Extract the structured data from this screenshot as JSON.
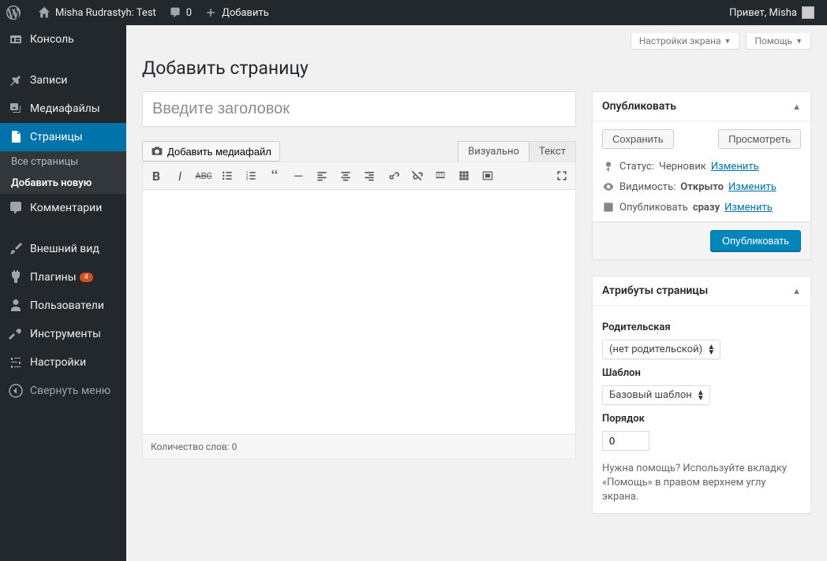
{
  "adminBar": {
    "siteName": "Misha Rudrastyh: Test",
    "comments": "0",
    "addNew": "Добавить",
    "greeting": "Привет, Misha"
  },
  "sidebar": {
    "items": [
      {
        "label": "Консоль"
      },
      {
        "label": "Записи"
      },
      {
        "label": "Медиафайлы"
      },
      {
        "label": "Страницы"
      },
      {
        "label": "Комментарии"
      },
      {
        "label": "Внешний вид"
      },
      {
        "label": "Плагины",
        "badge": "4"
      },
      {
        "label": "Пользователи"
      },
      {
        "label": "Инструменты"
      },
      {
        "label": "Настройки"
      }
    ],
    "sub": {
      "all": "Все страницы",
      "add": "Добавить новую"
    },
    "collapse": "Свернуть меню"
  },
  "screenOptions": "Настройки экрана",
  "help": "Помощь",
  "pageTitle": "Добавить страницу",
  "titlePlaceholder": "Введите заголовок",
  "addMedia": "Добавить медиафайл",
  "tabs": {
    "visual": "Визуально",
    "text": "Текст"
  },
  "wordCount": "Количество слов: 0",
  "publish": {
    "title": "Опубликовать",
    "save": "Сохранить",
    "preview": "Просмотреть",
    "statusLabel": "Статус:",
    "statusValue": "Черновик",
    "visibilityLabel": "Видимость:",
    "visibilityValue": "Открыто",
    "scheduleLabel": "Опубликовать",
    "scheduleValue": "сразу",
    "edit": "Изменить",
    "publish": "Опубликовать"
  },
  "attributes": {
    "title": "Атрибуты страницы",
    "parentLabel": "Родительская",
    "parentValue": "(нет родительской)",
    "templateLabel": "Шаблон",
    "templateValue": "Базовый шаблон",
    "orderLabel": "Порядок",
    "orderValue": "0",
    "helpText": "Нужна помощь? Используйте вкладку «Помощь» в правом верхнем углу экрана."
  }
}
